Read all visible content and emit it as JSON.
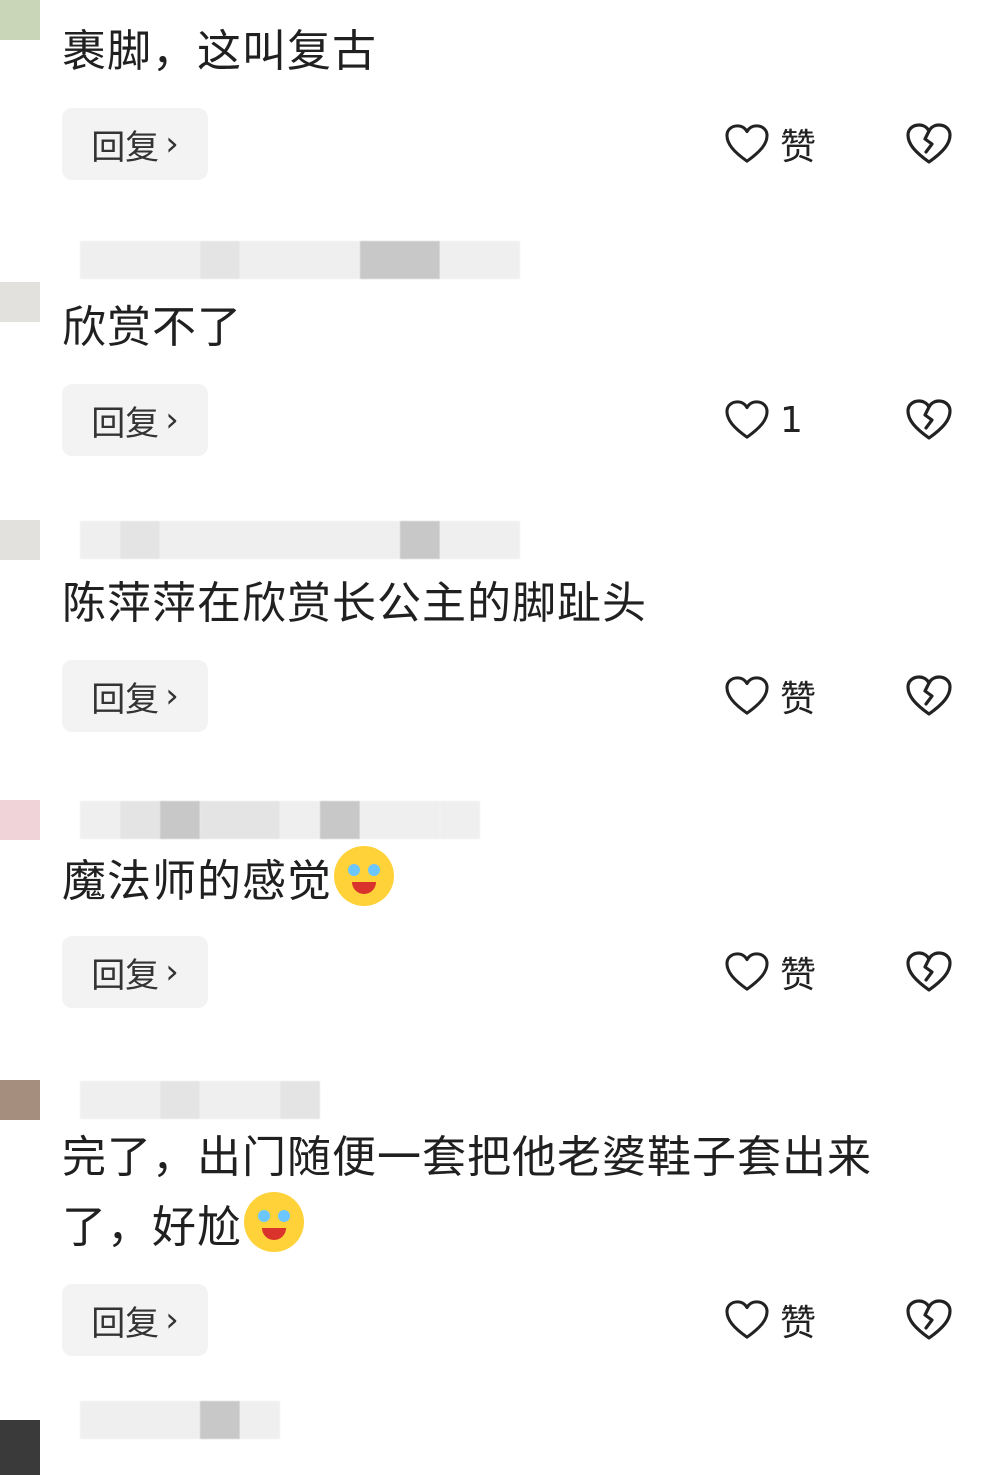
{
  "comments": [
    {
      "text": "裹脚，这叫复古",
      "reply_label": "回复",
      "reply_chevron": "›",
      "like_label": "赞",
      "like_icon": "heart-outline-icon",
      "dislike_icon": "broken-heart-icon"
    },
    {
      "text": "欣赏不了",
      "reply_label": "回复",
      "reply_chevron": "›",
      "like_label": "1",
      "like_icon": "heart-outline-icon",
      "dislike_icon": "broken-heart-icon"
    },
    {
      "text": "陈萍萍在欣赏长公主的脚趾头",
      "reply_label": "回复",
      "reply_chevron": "›",
      "like_label": "赞",
      "like_icon": "heart-outline-icon",
      "dislike_icon": "broken-heart-icon"
    },
    {
      "text": "魔法师的感觉",
      "emoji": "laughing-tears-emoji",
      "reply_label": "回复",
      "reply_chevron": "›",
      "like_label": "赞",
      "like_icon": "heart-outline-icon",
      "dislike_icon": "broken-heart-icon"
    },
    {
      "text_line1": "完了，出门随便一套把他老婆鞋子套出来",
      "text_line2": "了，好尬",
      "emoji": "crying-emoji",
      "reply_label": "回复",
      "reply_chevron": "›",
      "like_label": "赞",
      "like_icon": "heart-outline-icon",
      "dislike_icon": "broken-heart-icon"
    }
  ],
  "colors": {
    "text": "#202020",
    "reply_bg": "#f3f3f3",
    "emoji_yellow": "#ffd23a"
  }
}
